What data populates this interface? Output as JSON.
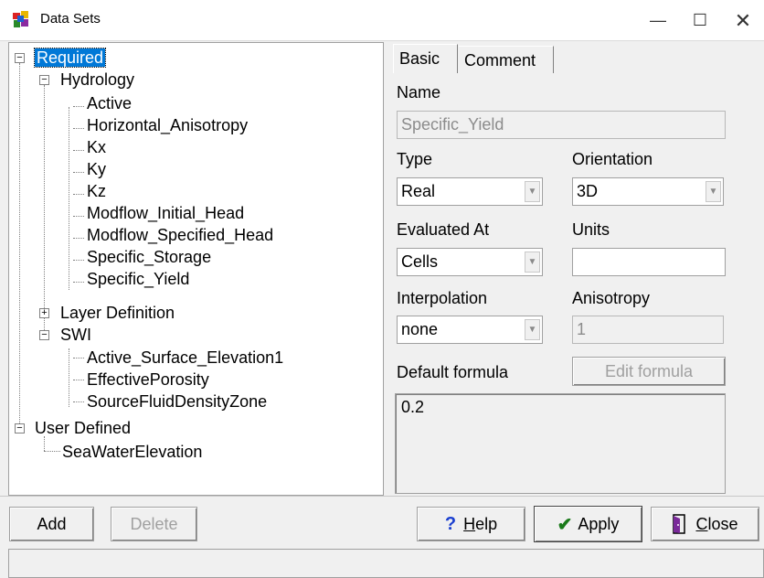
{
  "window": {
    "title": "Data Sets",
    "min_glyph": "—",
    "max_glyph": "☐",
    "close_glyph": "✕"
  },
  "tree": {
    "required": "Required",
    "hydrology": "Hydrology",
    "hydrology_items": [
      "Active",
      "Horizontal_Anisotropy",
      "Kx",
      "Ky",
      "Kz",
      "Modflow_Initial_Head",
      "Modflow_Specified_Head",
      "Specific_Storage",
      "Specific_Yield"
    ],
    "layer_definition": "Layer Definition",
    "swi": "SWI",
    "swi_items": [
      "Active_Surface_Elevation1",
      "EffectivePorosity",
      "SourceFluidDensityZone"
    ],
    "user_defined": "User Defined",
    "user_items": [
      "SeaWaterElevation"
    ],
    "minus": "−",
    "plus": "+"
  },
  "tabs": {
    "basic": "Basic",
    "comment": "Comment"
  },
  "form": {
    "name_label": "Name",
    "name_value": "Specific_Yield",
    "type_label": "Type",
    "type_value": "Real",
    "orientation_label": "Orientation",
    "orientation_value": "3D",
    "evaluated_label": "Evaluated At",
    "evaluated_value": "Cells",
    "units_label": "Units",
    "units_value": "",
    "interpolation_label": "Interpolation",
    "interpolation_value": "none",
    "anisotropy_label": "Anisotropy",
    "anisotropy_value": "1",
    "default_formula_label": "Default formula",
    "edit_formula_label": "Edit formula",
    "formula_value": "0.2",
    "arrow": "▼"
  },
  "buttons": {
    "add": "Add",
    "delete": "Delete",
    "help_icon": "?",
    "help_pre": "",
    "help_underline": "H",
    "help_rest": "elp",
    "apply_icon": "✔",
    "apply": "Apply",
    "close_underline": "C",
    "close_rest": "lose"
  },
  "colors": {
    "selection": "#0078d7",
    "help_icon": "#1a3fd0",
    "apply_icon": "#1a7a1a"
  }
}
